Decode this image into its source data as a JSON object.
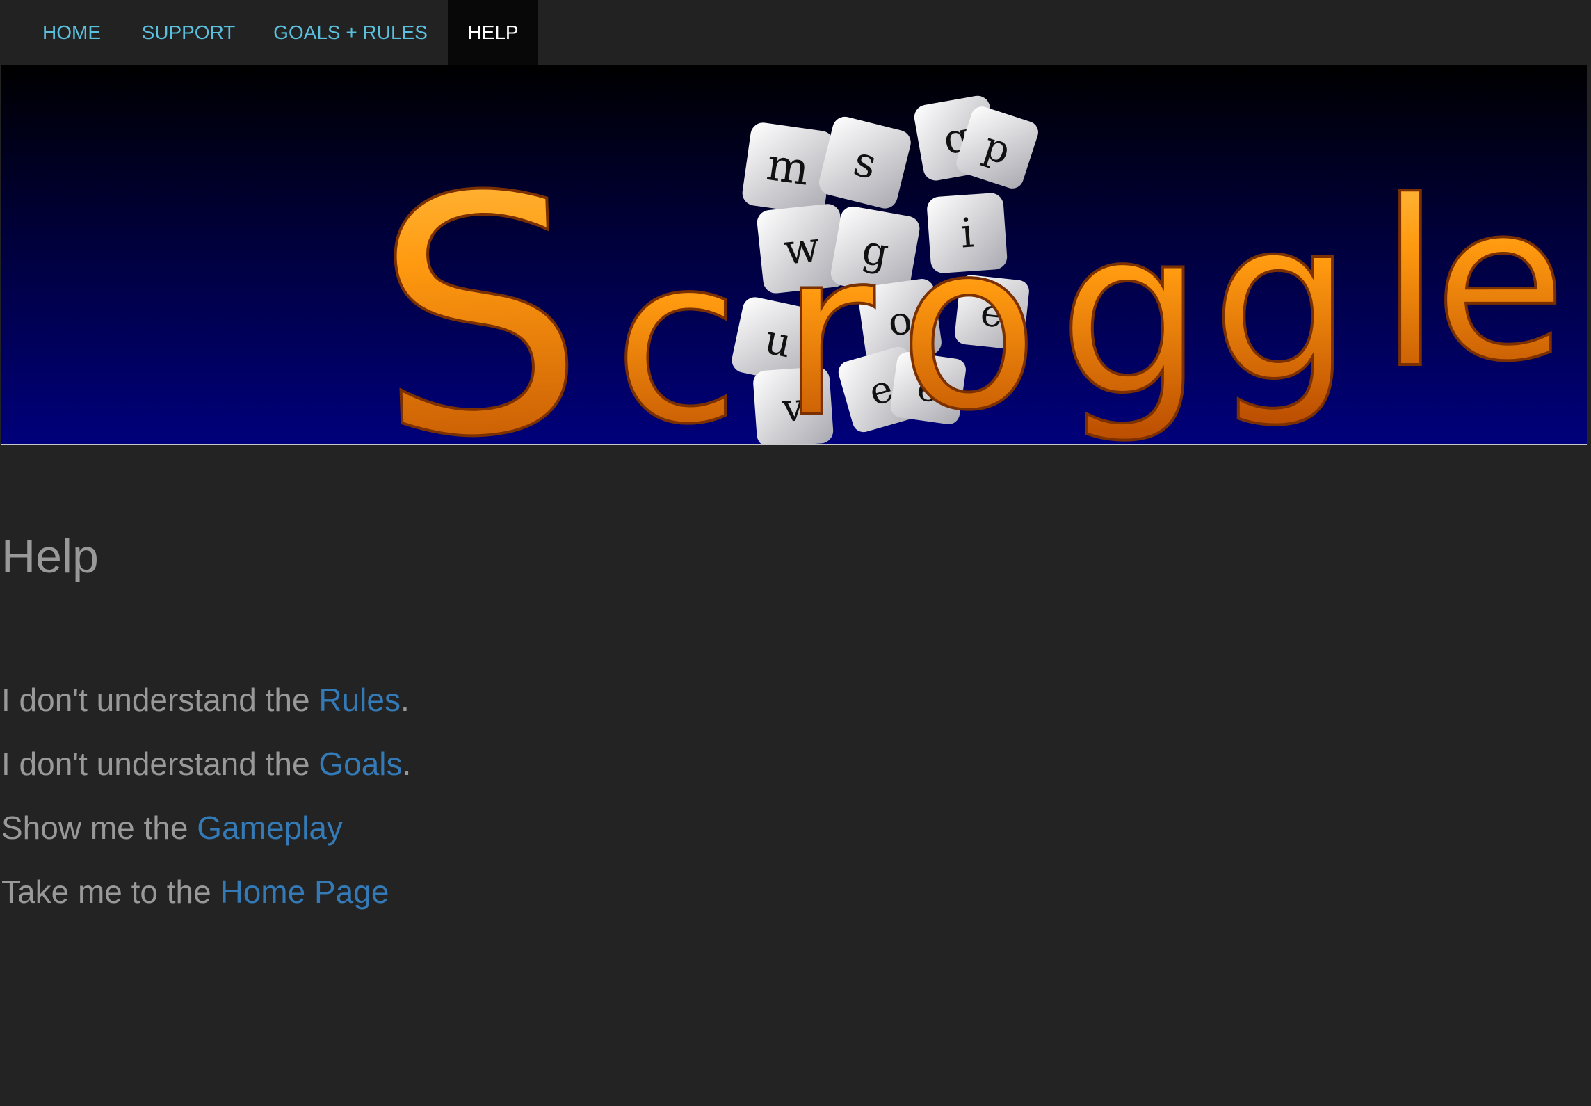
{
  "nav": {
    "items": [
      {
        "label": "HOME",
        "active": false
      },
      {
        "label": "SUPPORT",
        "active": false
      },
      {
        "label": "GOALS + RULES",
        "active": false
      },
      {
        "label": "HELP",
        "active": true
      }
    ]
  },
  "banner": {
    "logo_text": "Scroggle"
  },
  "main": {
    "title": "Help",
    "lines": [
      {
        "prefix": "I don't understand the ",
        "link": "Rules",
        "suffix": "."
      },
      {
        "prefix": "I don't understand the ",
        "link": "Goals",
        "suffix": "."
      },
      {
        "prefix": "Show me the ",
        "link": "Gameplay",
        "suffix": ""
      },
      {
        "prefix": "Take me to the ",
        "link": "Home Page",
        "suffix": ""
      }
    ]
  },
  "colors": {
    "background": "#232323",
    "nav_link": "#5bc0de",
    "nav_active_bg": "#080808",
    "link": "#337ab7",
    "text": "#999999",
    "logo_orange": "#ff8c00"
  }
}
